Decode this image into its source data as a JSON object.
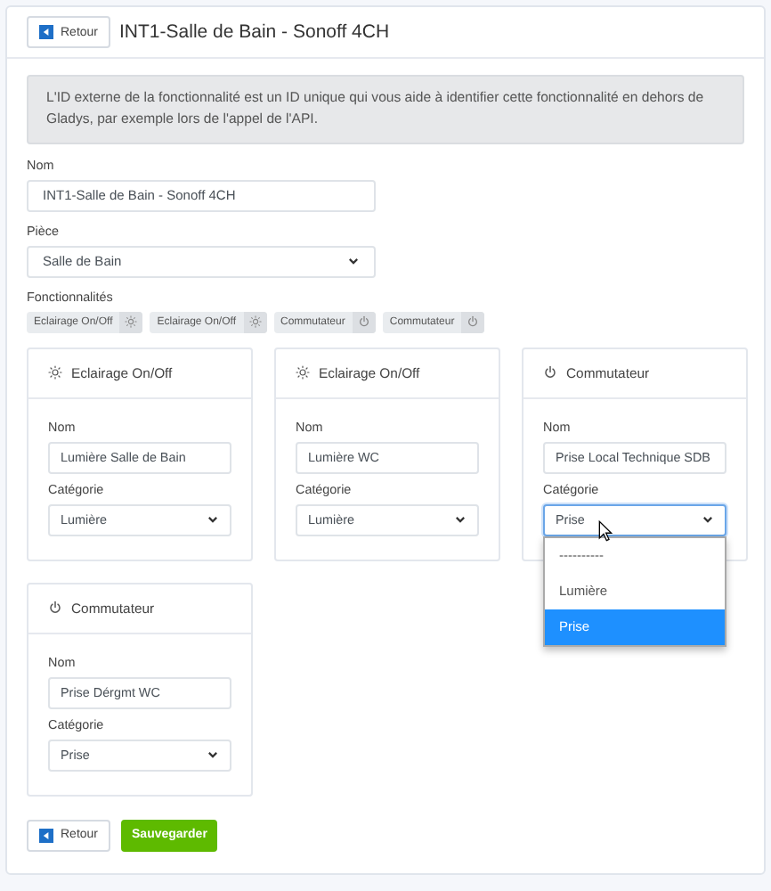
{
  "header": {
    "back_button": "Retour",
    "title": "INT1-Salle de Bain - Sonoff 4CH"
  },
  "alert": "L'ID externe de la fonctionnalité est un ID unique qui vous aide à identifier cette fonctionnalité en dehors de Gladys, par exemple lors de l'appel de l'API.",
  "fields": [
    {
      "kind": "input",
      "label": "Nom",
      "value": "INT1-Salle de Bain - Sonoff 4CH"
    },
    {
      "kind": "select",
      "label": "Pièce",
      "value": "Salle de Bain"
    }
  ],
  "features_label": "Fonctionnalités",
  "feature_tags": [
    {
      "kind": "light",
      "label": "Eclairage On/Off"
    },
    {
      "kind": "light",
      "label": "Eclairage On/Off"
    },
    {
      "kind": "switch",
      "label": "Commutateur"
    },
    {
      "kind": "switch",
      "label": "Commutateur"
    }
  ],
  "feature_cards": [
    {
      "kind": "light",
      "title": "Eclairage On/Off",
      "name_label": "Nom",
      "name": "Lumière Salle de Bain",
      "category_label": "Catégorie",
      "category": "Lumière",
      "open": false
    },
    {
      "kind": "light",
      "title": "Eclairage On/Off",
      "name_label": "Nom",
      "name": "Lumière WC",
      "category_label": "Catégorie",
      "category": "Lumière",
      "open": false
    },
    {
      "kind": "switch",
      "title": "Commutateur",
      "name_label": "Nom",
      "name": "Prise Local Technique SDB",
      "category_label": "Catégorie",
      "category": "Prise",
      "open": true,
      "options": [
        {
          "label": "----------",
          "selected": false
        },
        {
          "label": "Lumière",
          "selected": false
        },
        {
          "label": "Prise",
          "selected": true
        }
      ]
    },
    {
      "kind": "switch",
      "title": "Commutateur",
      "name_label": "Nom",
      "name": "Prise Dérgmt WC",
      "category_label": "Catégorie",
      "category": "Prise",
      "open": false
    }
  ],
  "footer_buttons": [
    {
      "kind": "back",
      "label": "Retour"
    },
    {
      "kind": "save",
      "label": "Sauvegarder"
    }
  ]
}
